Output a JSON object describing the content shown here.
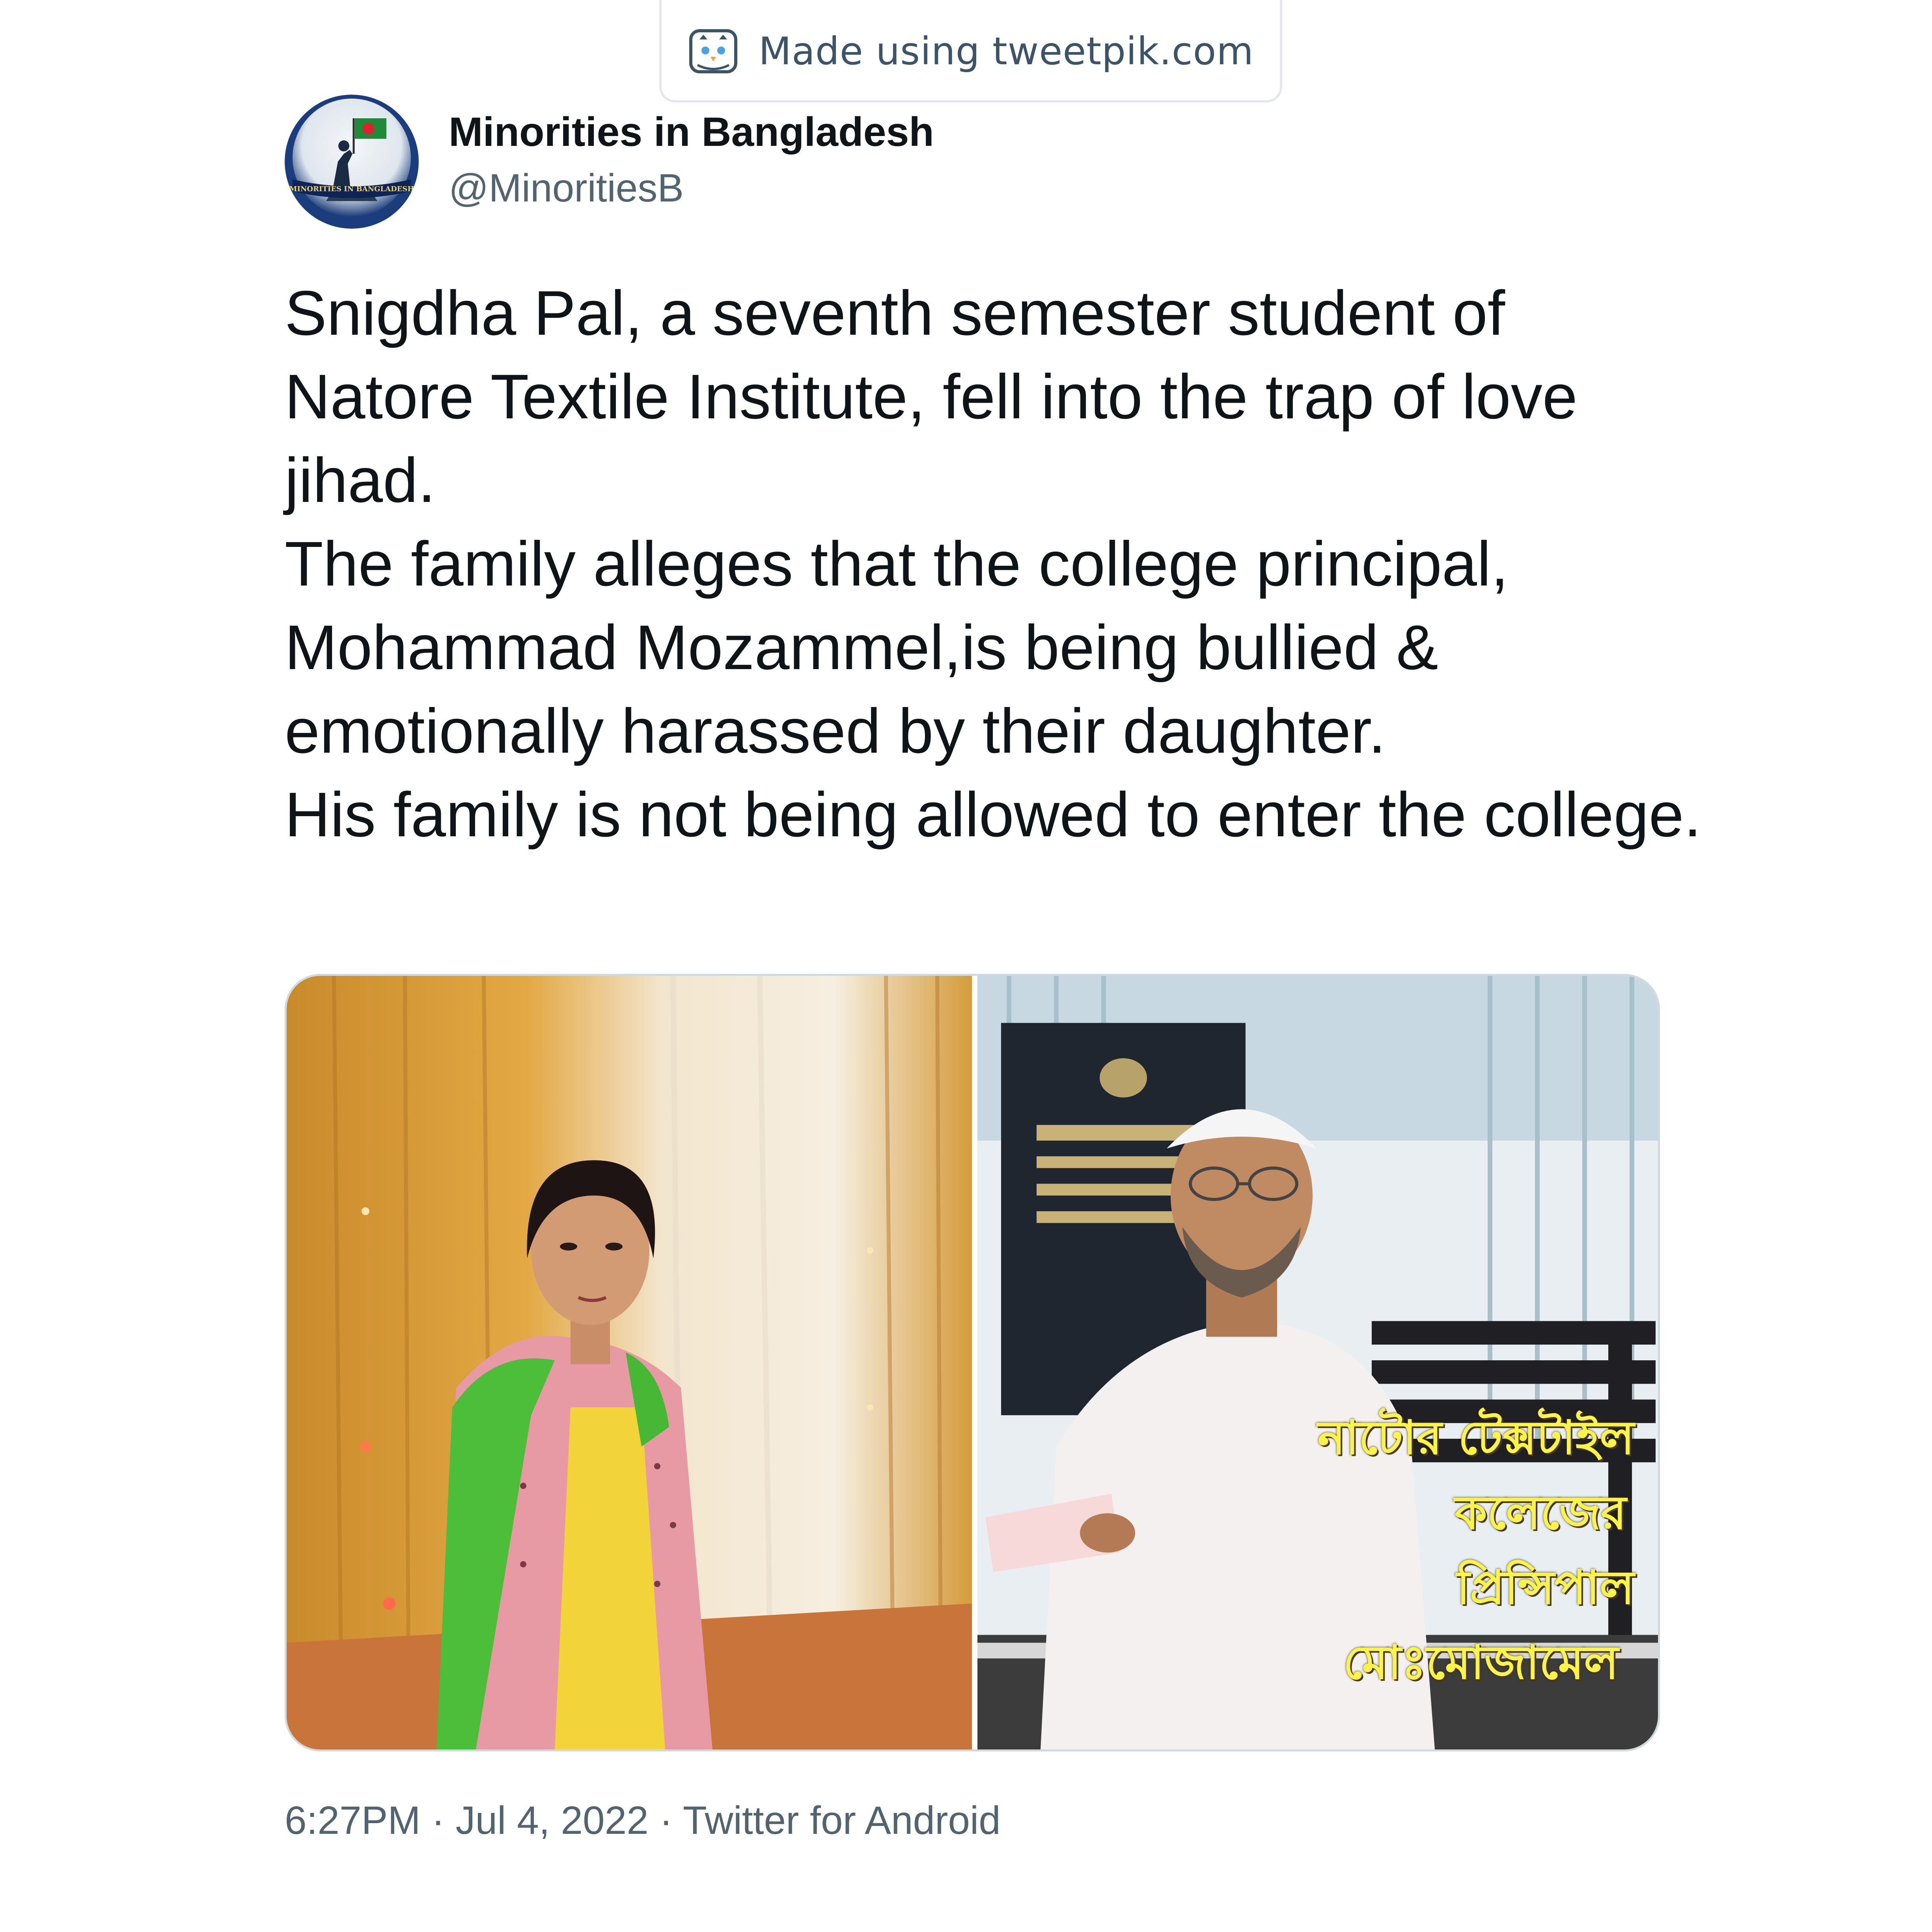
{
  "watermark": {
    "text": "Made using tweetpik.com",
    "icon": "tweetpik-bird-icon"
  },
  "author": {
    "display_name": "Minorities in Bangladesh",
    "handle": "@MinoritiesB",
    "avatar_text": "MINORITIES IN BANGLADESH"
  },
  "tweet": {
    "lines": [
      "Snigdha Pal, a seventh semester student of Natore Textile Institute, fell into the trap of love jihad.",
      "The family alleges that the college principal, Mohammad Mozammel,is being bullied & emotionally harassed by their daughter.",
      "His family is not being allowed to enter the college."
    ]
  },
  "media": {
    "left_photo": "photo-young-woman",
    "right_photo": "photo-principal",
    "caption_lines": [
      "নাটোর টেক্সটাইল",
      "কলেজের",
      "প্রিন্সিপাল",
      "মোঃমোজামেল"
    ]
  },
  "footer": {
    "time": "6:27PM",
    "date": "Jul 4, 2022",
    "source": "Twitter for Android",
    "separator": "·"
  },
  "colors": {
    "text_primary": "#0f1419",
    "text_secondary": "#536471",
    "caption_yellow": "#fbf24a"
  }
}
